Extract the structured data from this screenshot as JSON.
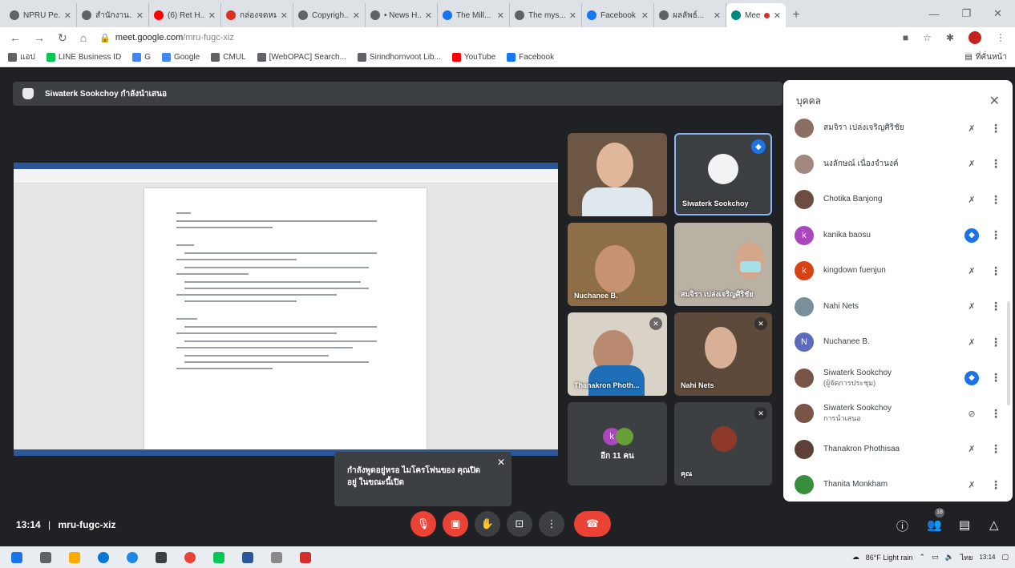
{
  "browser": {
    "tabs": [
      {
        "title": "NPRU Pe...",
        "color": "#5f6368"
      },
      {
        "title": "สำนักงาน...",
        "color": "#5f6368"
      },
      {
        "title": "(6) Ret H...",
        "color": "#ff0000"
      },
      {
        "title": "กล่องจดหมาย",
        "color": "#d93025"
      },
      {
        "title": "Copyrigh...",
        "color": "#5f6368"
      },
      {
        "title": "• News H...",
        "color": "#5f6368"
      },
      {
        "title": "The Mill...",
        "color": "#1a73e8"
      },
      {
        "title": "The mys...",
        "color": "#5f6368"
      },
      {
        "title": "Facebook",
        "color": "#1877f2"
      },
      {
        "title": "ผลลัพธ์...",
        "color": "#5f6368"
      },
      {
        "title": "Meet",
        "color": "#00897b",
        "active": true
      }
    ],
    "new_tab": "+",
    "url_domain": "meet.google.com",
    "url_path": "/mru-fugc-xiz",
    "bookmarks": [
      {
        "label": "แอป",
        "color": "#5f6368"
      },
      {
        "label": "LINE Business ID",
        "color": "#06c755"
      },
      {
        "label": "G",
        "color": "#4285f4"
      },
      {
        "label": "Google",
        "color": "#4285f4"
      },
      {
        "label": "CMUL",
        "color": "#5f6368"
      },
      {
        "label": "[WebOPAC] Search...",
        "color": "#5f6368"
      },
      {
        "label": "Sirindhornvoot Lib...",
        "color": "#5f6368"
      },
      {
        "label": "YouTube",
        "color": "#ff0000"
      },
      {
        "label": "Facebook",
        "color": "#1877f2"
      }
    ],
    "reading_list": "ที่คั่นหน้า"
  },
  "meet": {
    "presenting_banner": "Siwaterk Sookchoy กำลังนำเสนอ",
    "tiles": [
      {
        "name": "Siwaterk Sookchoy",
        "state": "speaking"
      },
      {
        "name": "Nuchanee B.",
        "state": "none"
      },
      {
        "name": "สมจิรา เปล่งเจริญศิริชัย",
        "state": "none"
      },
      {
        "name": "Thanakron Photh...",
        "state": "muted"
      },
      {
        "name": "Nahi Nets",
        "state": "muted"
      },
      {
        "name": "อีก 11 คน",
        "state": "none"
      },
      {
        "name": "คุณ",
        "state": "muted"
      }
    ],
    "toast": "กำลังพูดอยู่หรอ ไมโครโฟนของ คุณปิดอยู่ ในขณะนี้เปิด",
    "meeting_time": "13:14",
    "meeting_code": "mru-fugc-xiz",
    "participant_count": "18"
  },
  "people_panel": {
    "title": "บุคคล",
    "people": [
      {
        "name": "สมจิรา เปล่งเจริญศิริชัย",
        "sub": "",
        "mic": "muted",
        "avatar_color": "#8d6e63",
        "initial": ""
      },
      {
        "name": "นงลักษณ์ เนื่องจำนงค์",
        "sub": "",
        "mic": "muted",
        "avatar_color": "#a1887f",
        "initial": ""
      },
      {
        "name": "Chotika Banjong",
        "sub": "",
        "mic": "muted",
        "avatar_color": "#6d4c41",
        "initial": ""
      },
      {
        "name": "kanika baosu",
        "sub": "",
        "mic": "speaking",
        "avatar_color": "#ab47bc",
        "initial": "k"
      },
      {
        "name": "kingdown fuenjun",
        "sub": "",
        "mic": "muted",
        "avatar_color": "#d84315",
        "initial": "k"
      },
      {
        "name": "Nahi Nets",
        "sub": "",
        "mic": "muted",
        "avatar_color": "#78909c",
        "initial": ""
      },
      {
        "name": "Nuchanee B.",
        "sub": "",
        "mic": "muted",
        "avatar_color": "#5c6bc0",
        "initial": "N"
      },
      {
        "name": "Siwaterk Sookchoy",
        "sub": "(ผู้จัดการประชุม)",
        "mic": "speaking",
        "avatar_color": "#795548",
        "initial": ""
      },
      {
        "name": "Siwaterk Sookchoy",
        "sub": "การนำเสนอ",
        "mic": "presenting",
        "avatar_color": "#795548",
        "initial": ""
      },
      {
        "name": "Thanakron Phothisaa",
        "sub": "",
        "mic": "muted",
        "avatar_color": "#5d4037",
        "initial": ""
      },
      {
        "name": "Thanita Monkham",
        "sub": "",
        "mic": "muted",
        "avatar_color": "#388e3c",
        "initial": ""
      }
    ]
  },
  "taskbar": {
    "weather": "86°F Light rain",
    "time": "13:14",
    "lang": "ไทย"
  },
  "colors": {
    "meet_bg": "#202124",
    "tile_bg": "#3c4043",
    "accent_blue": "#1a73e8",
    "danger_red": "#ea4335"
  }
}
